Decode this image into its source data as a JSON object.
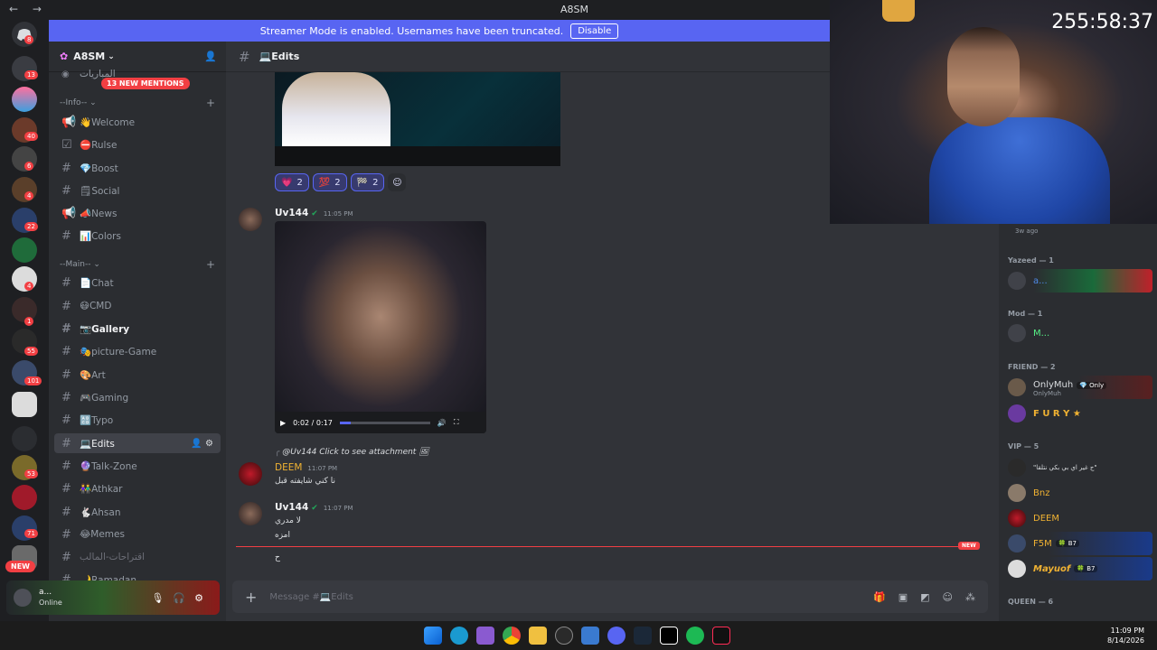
{
  "titlebar": {
    "nav": "← →",
    "title": "A8SM"
  },
  "banner": {
    "text": "Streamer Mode is enabled. Usernames have been truncated.",
    "button": "Disable"
  },
  "rail": {
    "badges": [
      "8",
      "13",
      "40",
      "6",
      "4",
      "22",
      "4",
      "1",
      "55",
      "101",
      "53",
      "71"
    ],
    "new_pill": "NEW"
  },
  "sidebar": {
    "server_name": "A8SM",
    "mentions": "13 NEW MENTIONS",
    "top_channel": "المباريات",
    "categories": {
      "info": "--Info--",
      "main": "--Main--"
    },
    "channels": [
      {
        "label": "👋Welcome"
      },
      {
        "label": "⛔Rulse"
      },
      {
        "label": "💎Boost"
      },
      {
        "label": "🗒Social"
      },
      {
        "label": "📣News"
      },
      {
        "label": "📊Colors"
      },
      {
        "label": "📄Chat"
      },
      {
        "label": "😷CMD"
      },
      {
        "label": "📷Gallery"
      },
      {
        "label": "🎭picture-Game"
      },
      {
        "label": "🎨Art"
      },
      {
        "label": "🎮Gaming"
      },
      {
        "label": "🔠Typo"
      },
      {
        "label": "💻Edits"
      },
      {
        "label": "🔮Talk-Zone"
      },
      {
        "label": "👫Athkar"
      },
      {
        "label": "🐇Ahsan"
      },
      {
        "label": "😂Memes"
      },
      {
        "label": "اقتراحات-المالب"
      },
      {
        "label": "🌙Ramadan"
      }
    ]
  },
  "user_panel": {
    "name": "a...",
    "status": "Online"
  },
  "chat": {
    "channel": "💻Edits",
    "reactions": [
      {
        "emoji": "💗",
        "count": "2"
      },
      {
        "emoji": "💯",
        "count": "2"
      },
      {
        "emoji": "🏁",
        "count": "2"
      }
    ],
    "messages": {
      "m1": {
        "author": "Uv144",
        "time": "11:05 PM"
      },
      "video": {
        "time": "0:02 / 0:17",
        "progress": 0.12
      },
      "reply": {
        "text": "@Uv144 Click to see attachment"
      },
      "m2": {
        "author": "DEEM",
        "time": "11:07 PM",
        "text": "نا كني شايفته قبل"
      },
      "m3": {
        "author": "Uv144",
        "time": "11:07 PM",
        "lines": [
          "لا مدري",
          "امزه"
        ]
      },
      "m4": {
        "text": "ح"
      }
    },
    "new_tag": "NEW",
    "composer_placeholder": "Message #💻Edits"
  },
  "members": {
    "partial_top": {
      "name": "",
      "sub": "3w ago"
    },
    "groups": [
      {
        "title": "Yazeed — 1",
        "items": [
          {
            "name": "a...",
            "color": "#4f8ae8"
          }
        ]
      },
      {
        "title": "Mod — 1",
        "items": [
          {
            "name": "M...",
            "color": "#57f287"
          }
        ]
      },
      {
        "title": "FRIEND — 2",
        "items": [
          {
            "name": "OnlyMuh",
            "tag": "💎 Only",
            "sub": "OnlyMuh",
            "color": "#dbdee1"
          },
          {
            "name": "F U R Y ★",
            "color": "#f0b232"
          }
        ]
      },
      {
        "title": "VIP — 5",
        "items": [
          {
            "name": "\"ج غير اي بي بكي نتلقا\"",
            "color": "#dbdee1"
          },
          {
            "name": "Bnz",
            "color": "#f0b232"
          },
          {
            "name": "DEEM",
            "color": "#f0b232"
          },
          {
            "name": "F5M",
            "tag": "🍀 B7",
            "color": "#f0b232"
          },
          {
            "name": "Mayuof",
            "tag": "🍀 B7",
            "color": "#f0b232"
          }
        ]
      },
      {
        "title": "QUEEN — 6",
        "items": []
      }
    ]
  },
  "webcam": {
    "timer": "255:58:37"
  },
  "taskbar": {
    "time": "11:09 PM",
    "date": "8/14/2026"
  }
}
